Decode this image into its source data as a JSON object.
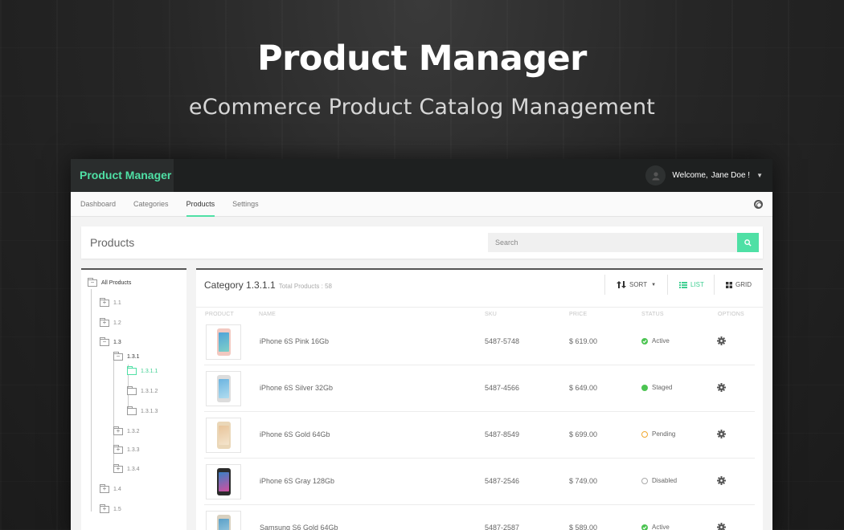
{
  "hero": {
    "title": "Product Manager",
    "subtitle": "eCommerce Product Catalog Management"
  },
  "app": {
    "brand": "Product Manager",
    "user": {
      "greeting": "Welcome,",
      "name": "Jane Doe !"
    },
    "nav": [
      "Dashboard",
      "Categories",
      "Products",
      "Settings"
    ],
    "active_nav": "Products",
    "page_title": "Products",
    "search": {
      "placeholder": "Search"
    },
    "tree": {
      "root": "All Products",
      "nodes": [
        "1.1",
        "1.2",
        "1.3",
        "1.3.1",
        "1.3.1.1",
        "1.3.1.2",
        "1.3.1.3",
        "1.3.2",
        "1.3.3",
        "1.3.4",
        "1.4",
        "1.5"
      ],
      "selected": "1.3.1.1"
    },
    "category": {
      "title": "Category 1.3.1.1",
      "count_label": "Total Products : 58"
    },
    "toolbar": {
      "sort": "SORT",
      "list": "LIST",
      "grid": "GRID"
    },
    "columns": [
      "PRODUCT",
      "NAME",
      "SKU",
      "PRICE",
      "STATUS",
      "OPTIONS"
    ],
    "products": [
      {
        "name": "iPhone 6S Pink 16Gb",
        "sku": "5487-5748",
        "price": "$ 619.00",
        "status": "Active"
      },
      {
        "name": "iPhone 6S Silver 32Gb",
        "sku": "5487-4566",
        "price": "$ 649.00",
        "status": "Staged"
      },
      {
        "name": "iPhone 6S Gold 64Gb",
        "sku": "5487-8549",
        "price": "$ 699.00",
        "status": "Pending"
      },
      {
        "name": "iPhone 6S Gray 128Gb",
        "sku": "5487-2546",
        "price": "$ 749.00",
        "status": "Disabled"
      },
      {
        "name": "Samsung S6 Gold 64Gb",
        "sku": "5487-2587",
        "price": "$ 589.00",
        "status": "Active"
      }
    ],
    "colors": {
      "accent": "#4fe0a5",
      "active": "#4cc452",
      "staged": "#4cc452",
      "pending": "#f0a830",
      "disabled": "#aaaaaa"
    }
  }
}
